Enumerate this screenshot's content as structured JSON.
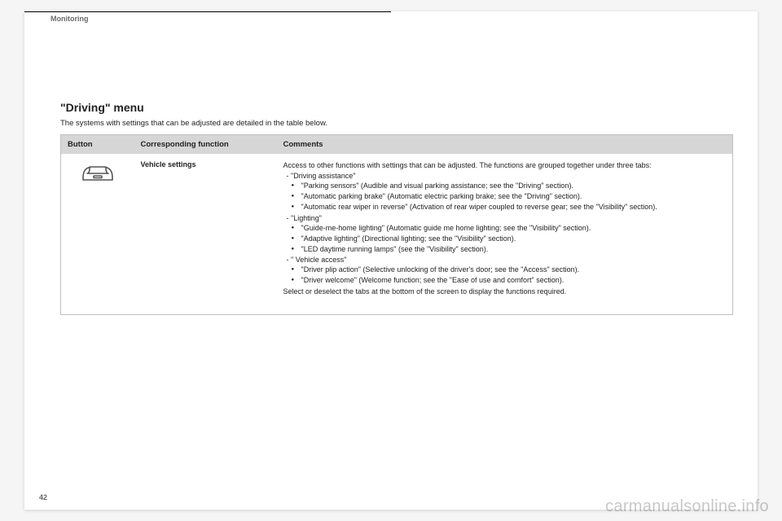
{
  "section": "Monitoring",
  "page_number": "42",
  "watermark": "carmanualsonline.info",
  "menu": {
    "title": "\"Driving\" menu",
    "subtitle": "The systems with settings that can be adjusted are detailed in the table below."
  },
  "table": {
    "headers": {
      "button": "Button",
      "function": "Corresponding function",
      "comments": "Comments"
    },
    "row": {
      "icon_name": "vehicle-settings-car-icon",
      "function_name": "Vehicle settings",
      "comments": {
        "intro": "Access to other functions with settings that can be adjusted. The functions are grouped together under three tabs:",
        "tabs": [
          {
            "label": "\"Driving assistance\"",
            "items": [
              "\"Parking sensors\" (Audible and visual parking assistance; see the \"Driving\" section).",
              "\"Automatic parking brake\" (Automatic electric parking brake; see the \"Driving\" section).",
              "\"Automatic rear wiper in reverse\" (Activation of rear wiper coupled to reverse gear; see the \"Visibility\" section)."
            ]
          },
          {
            "label": "\"Lighting\"",
            "items": [
              "\"Guide-me-home lighting\" (Automatic guide me home lighting; see the \"Visibility\" section).",
              "\"Adaptive lighting\" (Directional lighting; see the \"Visibility\" section).",
              "\"LED daytime running lamps\" (see the \"Visibility\" section)."
            ]
          },
          {
            "label": "\" Vehicle access\"",
            "items": [
              "\"Driver plip action\" (Selective unlocking of the driver's door; see the \"Access\" section).",
              "\"Driver welcome\" (Welcome function; see the \"Ease of use and comfort\" section)."
            ]
          }
        ],
        "outro": "Select or deselect the tabs at the bottom of the screen to display the functions required."
      }
    }
  }
}
